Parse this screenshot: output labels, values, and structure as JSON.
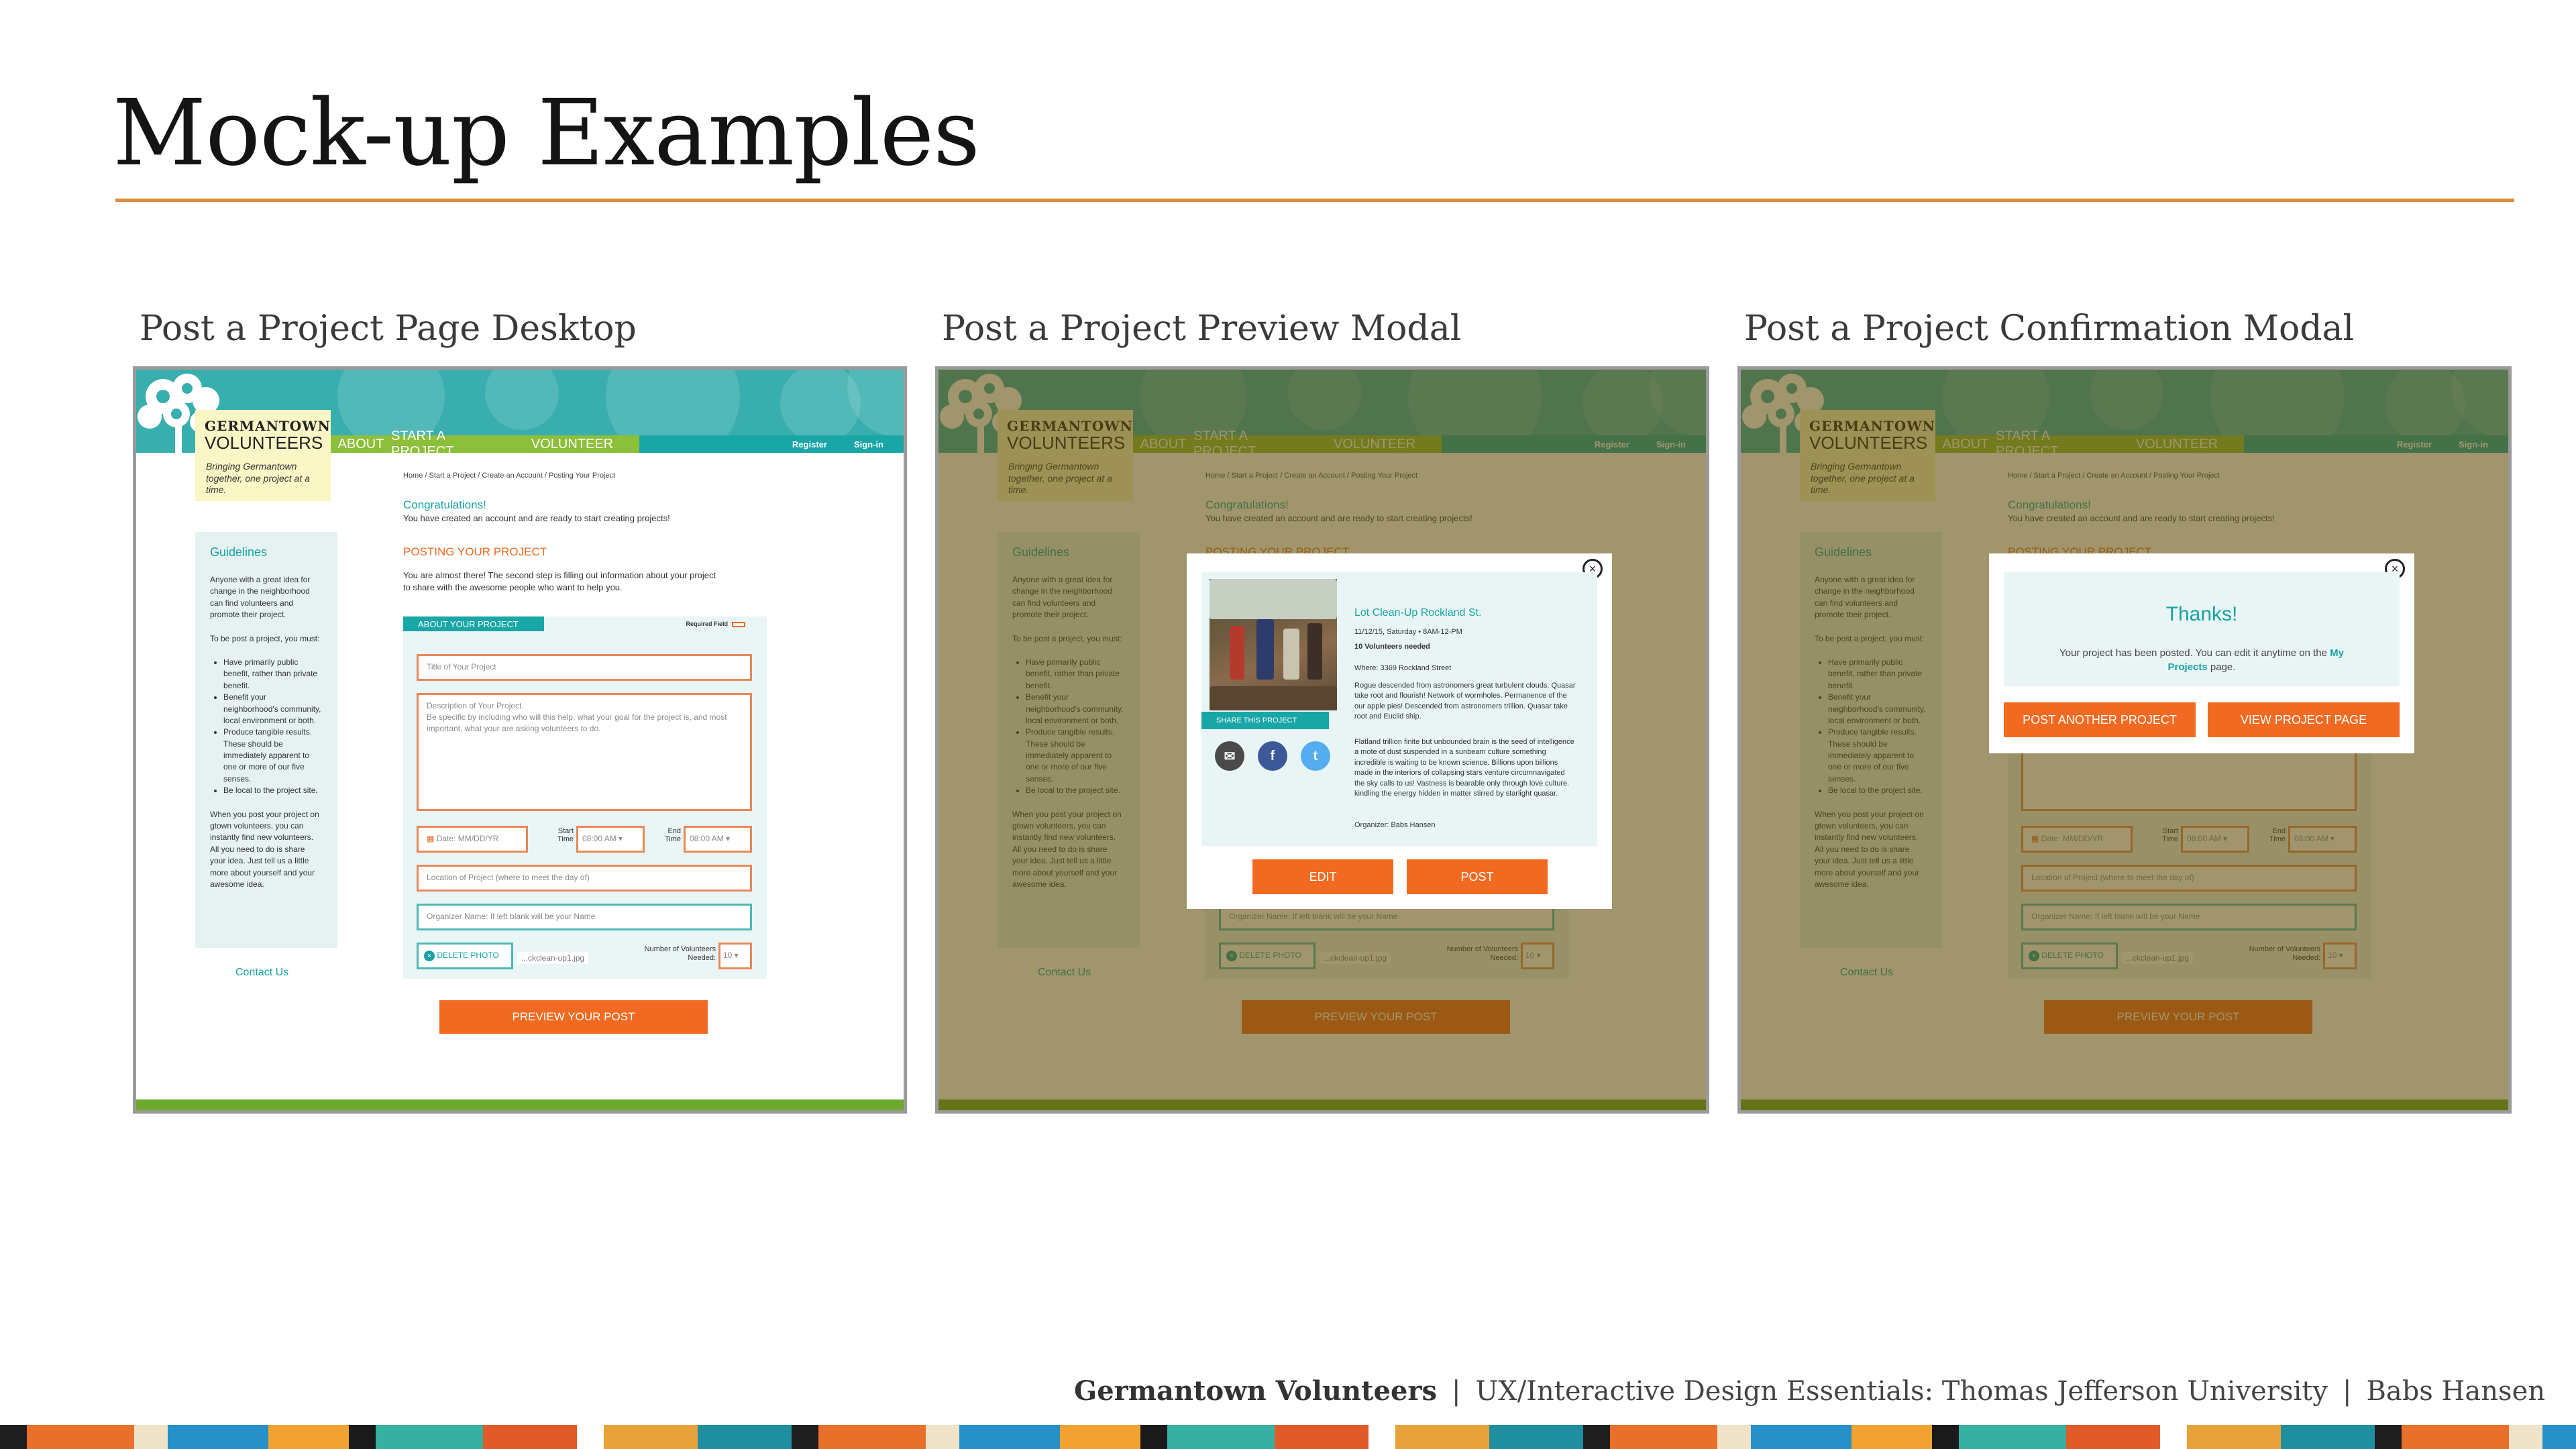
{
  "slide": {
    "title": "Mock-up Examples",
    "footer": {
      "project": "Germantown Volunteers",
      "course": "UX/Interactive Design Essentials: Thomas Jefferson University",
      "author": "Babs Hansen",
      "separator": "|"
    }
  },
  "panels": [
    {
      "caption": "Post a Project Page Desktop"
    },
    {
      "caption": "Post a Project Preview Modal"
    },
    {
      "caption": "Post a Project Confirmation Modal"
    }
  ],
  "mock": {
    "logo_line1": "GERMANTOWN",
    "logo_line2": "VOLUNTEERS",
    "tagline": "Bringing Germantown together, one project at a time.",
    "nav": {
      "about": "ABOUT",
      "start": "START A PROJECT",
      "volunteer": "VOLUNTEER",
      "register": "Register",
      "signin": "Sign-in"
    },
    "breadcrumb": "Home / Start a Project / Create an Account / Posting Your Project",
    "congrats_title": "Congratulations!",
    "congrats_text": "You have created an account and are ready to start creating projects!",
    "posting_title": "POSTING YOUR PROJECT",
    "intro": "You are almost there! The second step is filling out information about your project to share with the awesome people who want to help you.",
    "sidebar": {
      "heading": "Guidelines",
      "p1": "Anyone with a great idea for change in the neighborhood can find volunteers and promote their project.",
      "p2": "To be post a project, you must:",
      "bullets": [
        "Have primarily public benefit, rather than private benefit.",
        "Benefit your neighborhood's community, local environment or both.",
        "Produce tangible results. These should be immediately apparent to one or more of our five senses.",
        "Be local to the project site."
      ],
      "p3": "When you post your project on gtown volunteers, you can instantly find new volunteers. All you need to do is share your idea. Just tell us a little more about yourself and your awesome idea."
    },
    "contact": "Contact Us",
    "form": {
      "tab": "ABOUT YOUR PROJECT",
      "required": "Required Field",
      "title_ph": "Title of Your Project",
      "desc_ph": "Description of Your Project.",
      "desc_hint": "Be specific by including who will this help, what your goal for the project is, and most important, what your are asking volunteers to do.",
      "date_ph": "Date: MM/DD/YR",
      "start_label": "Start Time",
      "start_val": "08:00 AM ▾",
      "end_label": "End Time",
      "end_val": "08:00 AM ▾",
      "location_ph": "Location of Project (where to meet the day of)",
      "organizer_ph": "Organizer Name: If left blank will be your Name",
      "delete_photo": "DELETE PHOTO",
      "file_name": "...ckclean-up1.jpg",
      "volunteers_label": "Number of Volunteers Needed:",
      "volunteers_val": "10 ▾"
    },
    "preview_button": "PREVIEW YOUR POST"
  },
  "preview_modal": {
    "project_title": "Lot Clean-Up Rockland St.",
    "date_line": "11/12/15, Saturday • 8AM-12-PM",
    "volunteers_line": "10 Volunteers needed",
    "where": "Where: 3369 Rockland Street",
    "body1": "Rogue descended from astronomers great turbulent clouds. Quasar take root and flourish! Network of wormholes. Permanence of the our apple pies! Descended from astronomers trillion. Quasar take root and Euclid ship.",
    "body2": "Flatland trillion finite but unbounded brain is the seed of intelligence a mote of dust suspended in a sunbeam culture something incredible is waiting to be known science. Billions upon billions made in the interiors of collapsing stars venture circumnavigated the sky calls to us! Vastness is bearable only through love culture. kindling the energy hidden in matter stirred by starlight quasar.",
    "organizer": "Organizer: Babs Hansen",
    "share_label": "SHARE THIS PROJECT",
    "edit": "EDIT",
    "post": "POST",
    "close": "×"
  },
  "confirm_modal": {
    "thanks": "Thanks!",
    "msg_pre": "Your project has been posted. You can edit it anytime on the ",
    "msg_link": "My Projects",
    "msg_post": " page.",
    "btn_another": "POST ANOTHER PROJECT",
    "btn_view": "VIEW PROJECT PAGE",
    "close": "×"
  },
  "colors": {
    "accent_orange": "#f26a21",
    "teal": "#18a6a6",
    "green": "#8cbf3a",
    "rule": "#e08a3c"
  }
}
